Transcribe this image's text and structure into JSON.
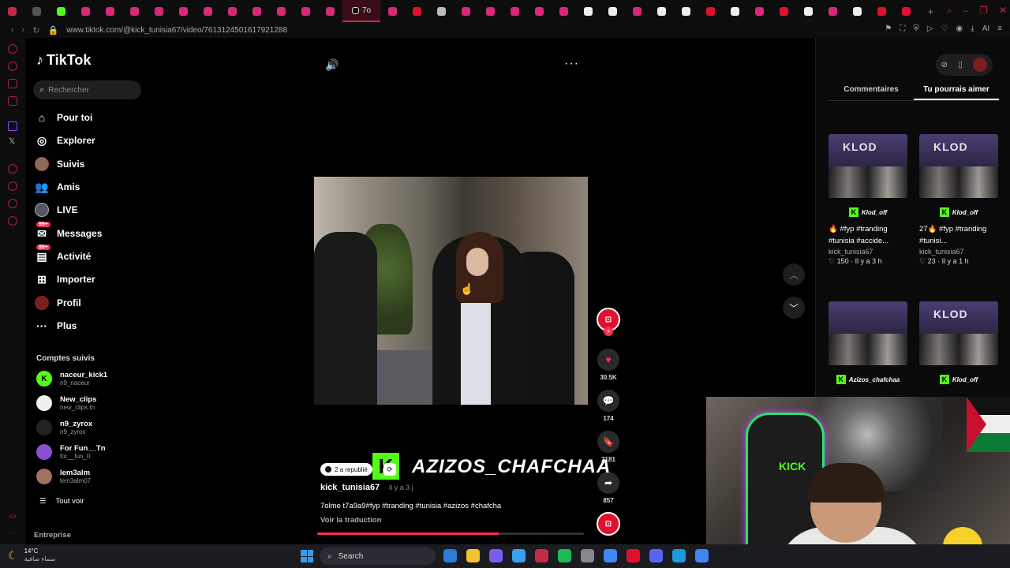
{
  "browser": {
    "url": "www.tiktok.com/@kick_tunisia67/video/7613124501617921288",
    "active_tab_label": "7o",
    "tab_icons": [
      {
        "name": "tab-opera",
        "color": "#c22b46"
      },
      {
        "name": "tab-misc",
        "color": "#555555"
      },
      {
        "name": "tab-kick",
        "color": "#53fc18"
      },
      {
        "name": "tab-instagram",
        "color": "#d62976"
      },
      {
        "name": "tab-instagram",
        "color": "#d62976"
      },
      {
        "name": "tab-instagram",
        "color": "#d62976"
      },
      {
        "name": "tab-instagram",
        "color": "#d62976"
      },
      {
        "name": "tab-instagram",
        "color": "#d62976"
      },
      {
        "name": "tab-instagram",
        "color": "#d62976"
      },
      {
        "name": "tab-instagram",
        "color": "#d62976"
      },
      {
        "name": "tab-instagram",
        "color": "#d62976"
      },
      {
        "name": "tab-instagram",
        "color": "#d62976"
      },
      {
        "name": "tab-instagram",
        "color": "#d62976"
      },
      {
        "name": "tab-instagram",
        "color": "#d62976"
      }
    ],
    "tab_icons_after": [
      {
        "name": "tab-instagram",
        "color": "#d62976"
      },
      {
        "name": "tab-youtube",
        "color": "#e0112e"
      },
      {
        "name": "tab-document",
        "color": "#bbbbbb"
      },
      {
        "name": "tab-instagram",
        "color": "#d62976"
      },
      {
        "name": "tab-instagram",
        "color": "#d62976"
      },
      {
        "name": "tab-instagram",
        "color": "#d62976"
      },
      {
        "name": "tab-instagram",
        "color": "#d62976"
      },
      {
        "name": "tab-instagram",
        "color": "#d62976"
      },
      {
        "name": "tab-tiktok",
        "color": "#eeeeee"
      },
      {
        "name": "tab-tiktok",
        "color": "#eeeeee"
      },
      {
        "name": "tab-instagram",
        "color": "#d62976"
      },
      {
        "name": "tab-tiktok",
        "color": "#eeeeee"
      },
      {
        "name": "tab-tiktok",
        "color": "#eeeeee"
      },
      {
        "name": "tab-youtube",
        "color": "#e0112e"
      },
      {
        "name": "tab-tiktok",
        "color": "#eeeeee"
      },
      {
        "name": "tab-instagram",
        "color": "#d62976"
      },
      {
        "name": "tab-youtube",
        "color": "#e0112e"
      },
      {
        "name": "tab-tiktok",
        "color": "#eeeeee"
      },
      {
        "name": "tab-instagram",
        "color": "#d62976"
      },
      {
        "name": "tab-tiktok",
        "color": "#eeeeee"
      },
      {
        "name": "tab-youtube",
        "color": "#e0112e"
      },
      {
        "name": "tab-youtube",
        "color": "#e0112e"
      }
    ],
    "address_right_label": "AI"
  },
  "tiktok": {
    "logo_text": "TikTok",
    "search_placeholder": "Rechercher",
    "nav": {
      "for_you": "Pour toi",
      "explore": "Explorer",
      "following": "Suivis",
      "friends": "Amis",
      "live": "LIVE",
      "messages": "Messages",
      "activity": "Activité",
      "upload": "Importer",
      "profile": "Profil",
      "more": "Plus"
    },
    "badges": {
      "messages": "99+",
      "activity": "99+"
    },
    "followed_title": "Comptes suivis",
    "followed": [
      {
        "name": "naceur_kick1",
        "handle": "n9_naceur",
        "avatar_text": "K",
        "avatar_color": "#53fc18"
      },
      {
        "name": "New_clips",
        "handle": "new_clips.tn",
        "avatar_text": "",
        "avatar_color": "#eeeeee"
      },
      {
        "name": "n9_zyrox",
        "handle": "n9_zyrox",
        "avatar_text": "",
        "avatar_color": "#222222"
      },
      {
        "name": "For Fun__Tn",
        "handle": "for__fun_0",
        "avatar_text": "",
        "avatar_color": "#8a4fd0"
      },
      {
        "name": "lem3alm",
        "handle": "lem3alm07",
        "avatar_text": "",
        "avatar_color": "#a07060"
      }
    ],
    "see_all": "Tout voir",
    "company": "Entreprise"
  },
  "video": {
    "overlay_name": "AZIZOS_CHAFCHAA",
    "overlay_logo": "K",
    "republished": "2 a republié",
    "author": "kick_tunisia67",
    "time_ago": "· Il y a 3 j",
    "caption": "7olme t7a9a9#fyp #tranding #tunisia #azizos #chafcha",
    "translate": "Voir la traduction",
    "progress": 0.68,
    "likes": "30.5K",
    "comments": "174",
    "saves": "2181",
    "shares": "857"
  },
  "right_panel": {
    "tabs": [
      "Commentaires",
      "Tu pourrais aimer"
    ],
    "active_tab": "Tu pourrais aimer",
    "cards": [
      {
        "brand": "Klod_off",
        "thumb_text": "KLOD",
        "title": "🔥 #fyp #tranding #tunisia #accide...",
        "user": "kick_tunisia67",
        "meta": "♡ 150 · Il y a 3 h"
      },
      {
        "brand": "Klod_off",
        "thumb_text": "KLOD",
        "title": "27🔥 #fyp #tranding #tunisi...",
        "user": "kick_tunisia67",
        "meta": "♡ 23 · Il y a 1 h"
      },
      {
        "brand": "Azizos_chafchaa",
        "thumb_text": "",
        "title": "",
        "user": "",
        "meta": ""
      },
      {
        "brand": "Klod_off",
        "thumb_text": "KLOD",
        "title": "",
        "user": "",
        "meta": ""
      }
    ]
  },
  "webcam": {
    "sign_text": "KICK"
  },
  "taskbar": {
    "temp": "14°C",
    "weather_desc": "سماء صافية",
    "search_label": "Search",
    "app_colors": [
      "#2d7bd6",
      "#f1c232",
      "#7b5cf0",
      "#3aa0f0",
      "#c22b46",
      "#1db954",
      "#888888",
      "#4285f4",
      "#e0112e",
      "#5865f2",
      "#1b9ae0",
      "#4285f4"
    ]
  }
}
